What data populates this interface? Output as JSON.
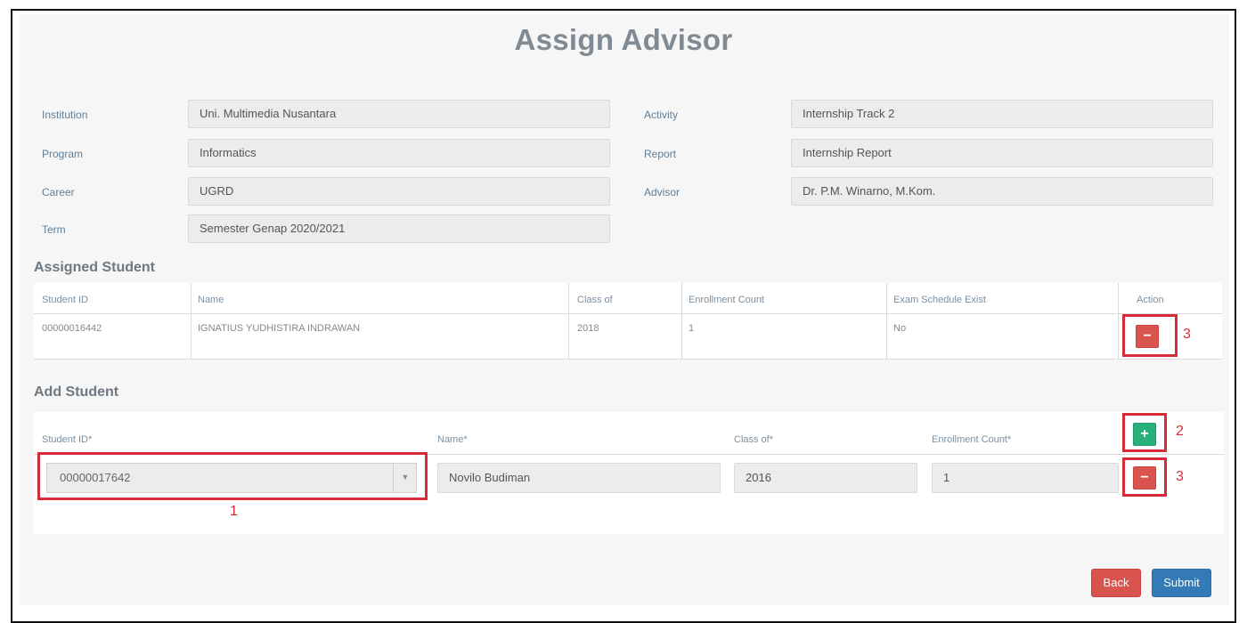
{
  "page": {
    "title": "Assign Advisor"
  },
  "info": {
    "institution_label": "Institution",
    "institution_value": "Uni. Multimedia Nusantara",
    "program_label": "Program",
    "program_value": "Informatics",
    "career_label": "Career",
    "career_value": "UGRD",
    "term_label": "Term",
    "term_value": "Semester Genap 2020/2021",
    "activity_label": "Activity",
    "activity_value": "Internship Track 2",
    "report_label": "Report",
    "report_value": "Internship Report",
    "advisor_label": "Advisor",
    "advisor_value": "Dr. P.M. Winarno, M.Kom."
  },
  "assigned": {
    "heading": "Assigned Student",
    "headers": [
      "Student ID",
      "Name",
      "Class of",
      "Enrollment Count",
      "Exam Schedule Exist",
      "Action"
    ],
    "rows": [
      {
        "student_id": "00000016442",
        "name": "IGNATIUS YUDHISTIRA INDRAWAN",
        "class_of": "2018",
        "enrollment_count": "1",
        "exam_schedule_exist": "No"
      }
    ]
  },
  "add": {
    "heading": "Add Student",
    "student_id_label": "Student ID*",
    "name_label": "Name*",
    "class_label": "Class of*",
    "enroll_label": "Enrollment Count*",
    "student_id_value": "00000017642",
    "name_value": "Novilo Budiman",
    "class_value": "2016",
    "enroll_value": "1"
  },
  "buttons": {
    "add": "+",
    "remove": "−",
    "back": "Back",
    "submit": "Submit"
  },
  "annotations": {
    "one": "1",
    "two": "2",
    "three_a": "3",
    "three_b": "3"
  },
  "colors": {
    "danger": "#d9534f",
    "success": "#28b07a",
    "primary": "#337ab7",
    "highlight": "#d62c37"
  }
}
